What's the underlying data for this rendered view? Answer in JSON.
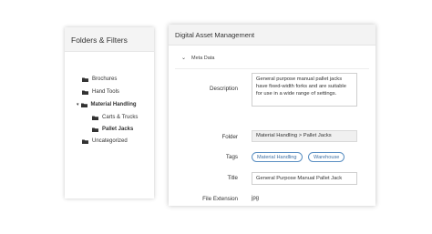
{
  "folders_panel": {
    "title": "Folders & Filters",
    "items": [
      {
        "label": "Brochures"
      },
      {
        "label": "Hand Tools"
      },
      {
        "label": "Material Handling"
      },
      {
        "label": "Carts & Trucks"
      },
      {
        "label": "Pallet Jacks"
      },
      {
        "label": "Uncategorized"
      }
    ],
    "expanded_caret": "▾"
  },
  "dam": {
    "title": "Digital Asset Management",
    "meta_section_label": "Meta Data",
    "meta_toggle_chevron": "⌄",
    "fields": {
      "description_label": "Description",
      "description_value": "General purpose manual pallet jacks have fixed-width forks and are suitable for use in a wide range of settings.",
      "folder_label": "Folder",
      "folder_value": "Material Handling > Pallet Jacks",
      "tags_label": "Tags",
      "tags": [
        "Material Handling",
        "Warehouse"
      ],
      "title_label": "Title",
      "title_value": "General Purpose Manual Pallet Jack",
      "file_extension_label": "File Extension",
      "file_extension_value": "jpg"
    }
  },
  "colors": {
    "folder_icon": "#333333",
    "tag_border": "#5a8fc2",
    "header_bg": "#f3f3f3"
  }
}
